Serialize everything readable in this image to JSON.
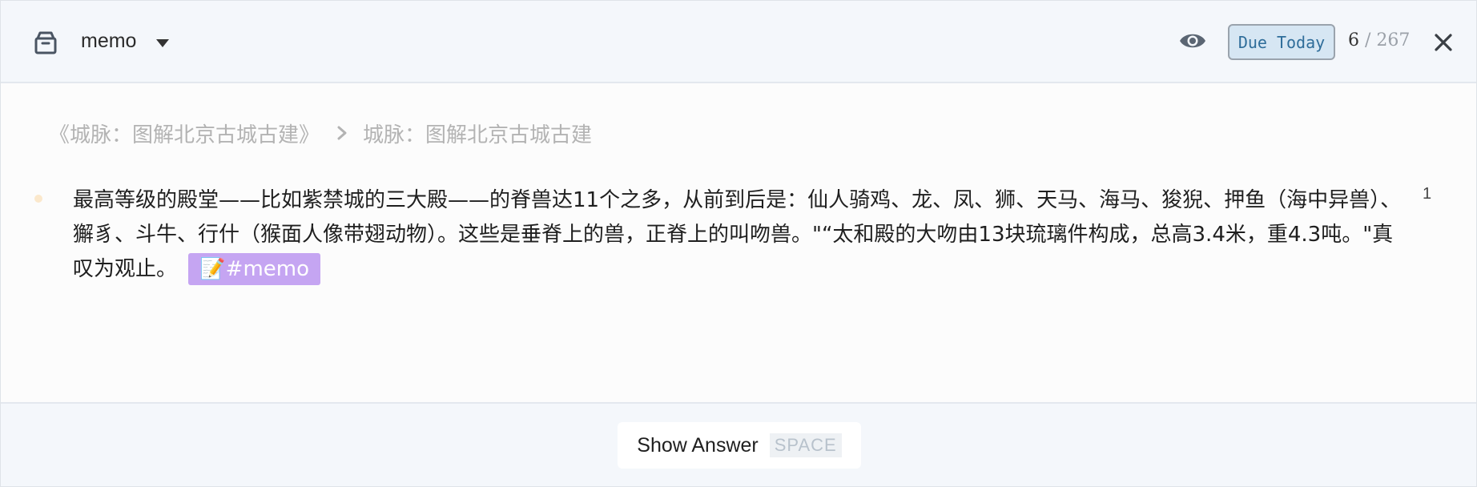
{
  "header": {
    "deck_icon": "archive-box-icon",
    "deck_name": "memo",
    "dropdown_icon": "caret-down-icon",
    "visibility_icon": "eye-icon",
    "due_button_label": "Due Today",
    "counter_current": "6",
    "counter_separator": "/",
    "counter_total": "267",
    "close_icon": "close-icon"
  },
  "breadcrumb": {
    "items": [
      "《城脉：图解北京古城古建》",
      "城脉：图解北京古城古建"
    ],
    "separator_icon": "chevron-right-icon"
  },
  "card": {
    "text": "最高等级的殿堂——比如紫禁城的三大殿——的脊兽达11个之多，从前到后是：仙人骑鸡、龙、凤、狮、天马、海马、狻猊、押鱼（海中异兽）、獬豸、斗牛、行什（猴面人像带翅动物）。这些是垂脊上的兽，正脊上的叫吻兽。\"“太和殿的大吻由13块琉璃件构成，总高3.4米，重4.3吨。\"真叹为观止。",
    "tag": "📝#memo",
    "reference_count": "1"
  },
  "footer": {
    "show_answer_label": "Show Answer",
    "shortcut_key": "SPACE"
  },
  "colors": {
    "header_bg": "#f4f7fb",
    "due_button_bg": "#d6e6f3",
    "due_button_text": "#2f6d9a",
    "tag_bg": "#c5a5f2",
    "breadcrumb_text": "#b3b3b3"
  }
}
